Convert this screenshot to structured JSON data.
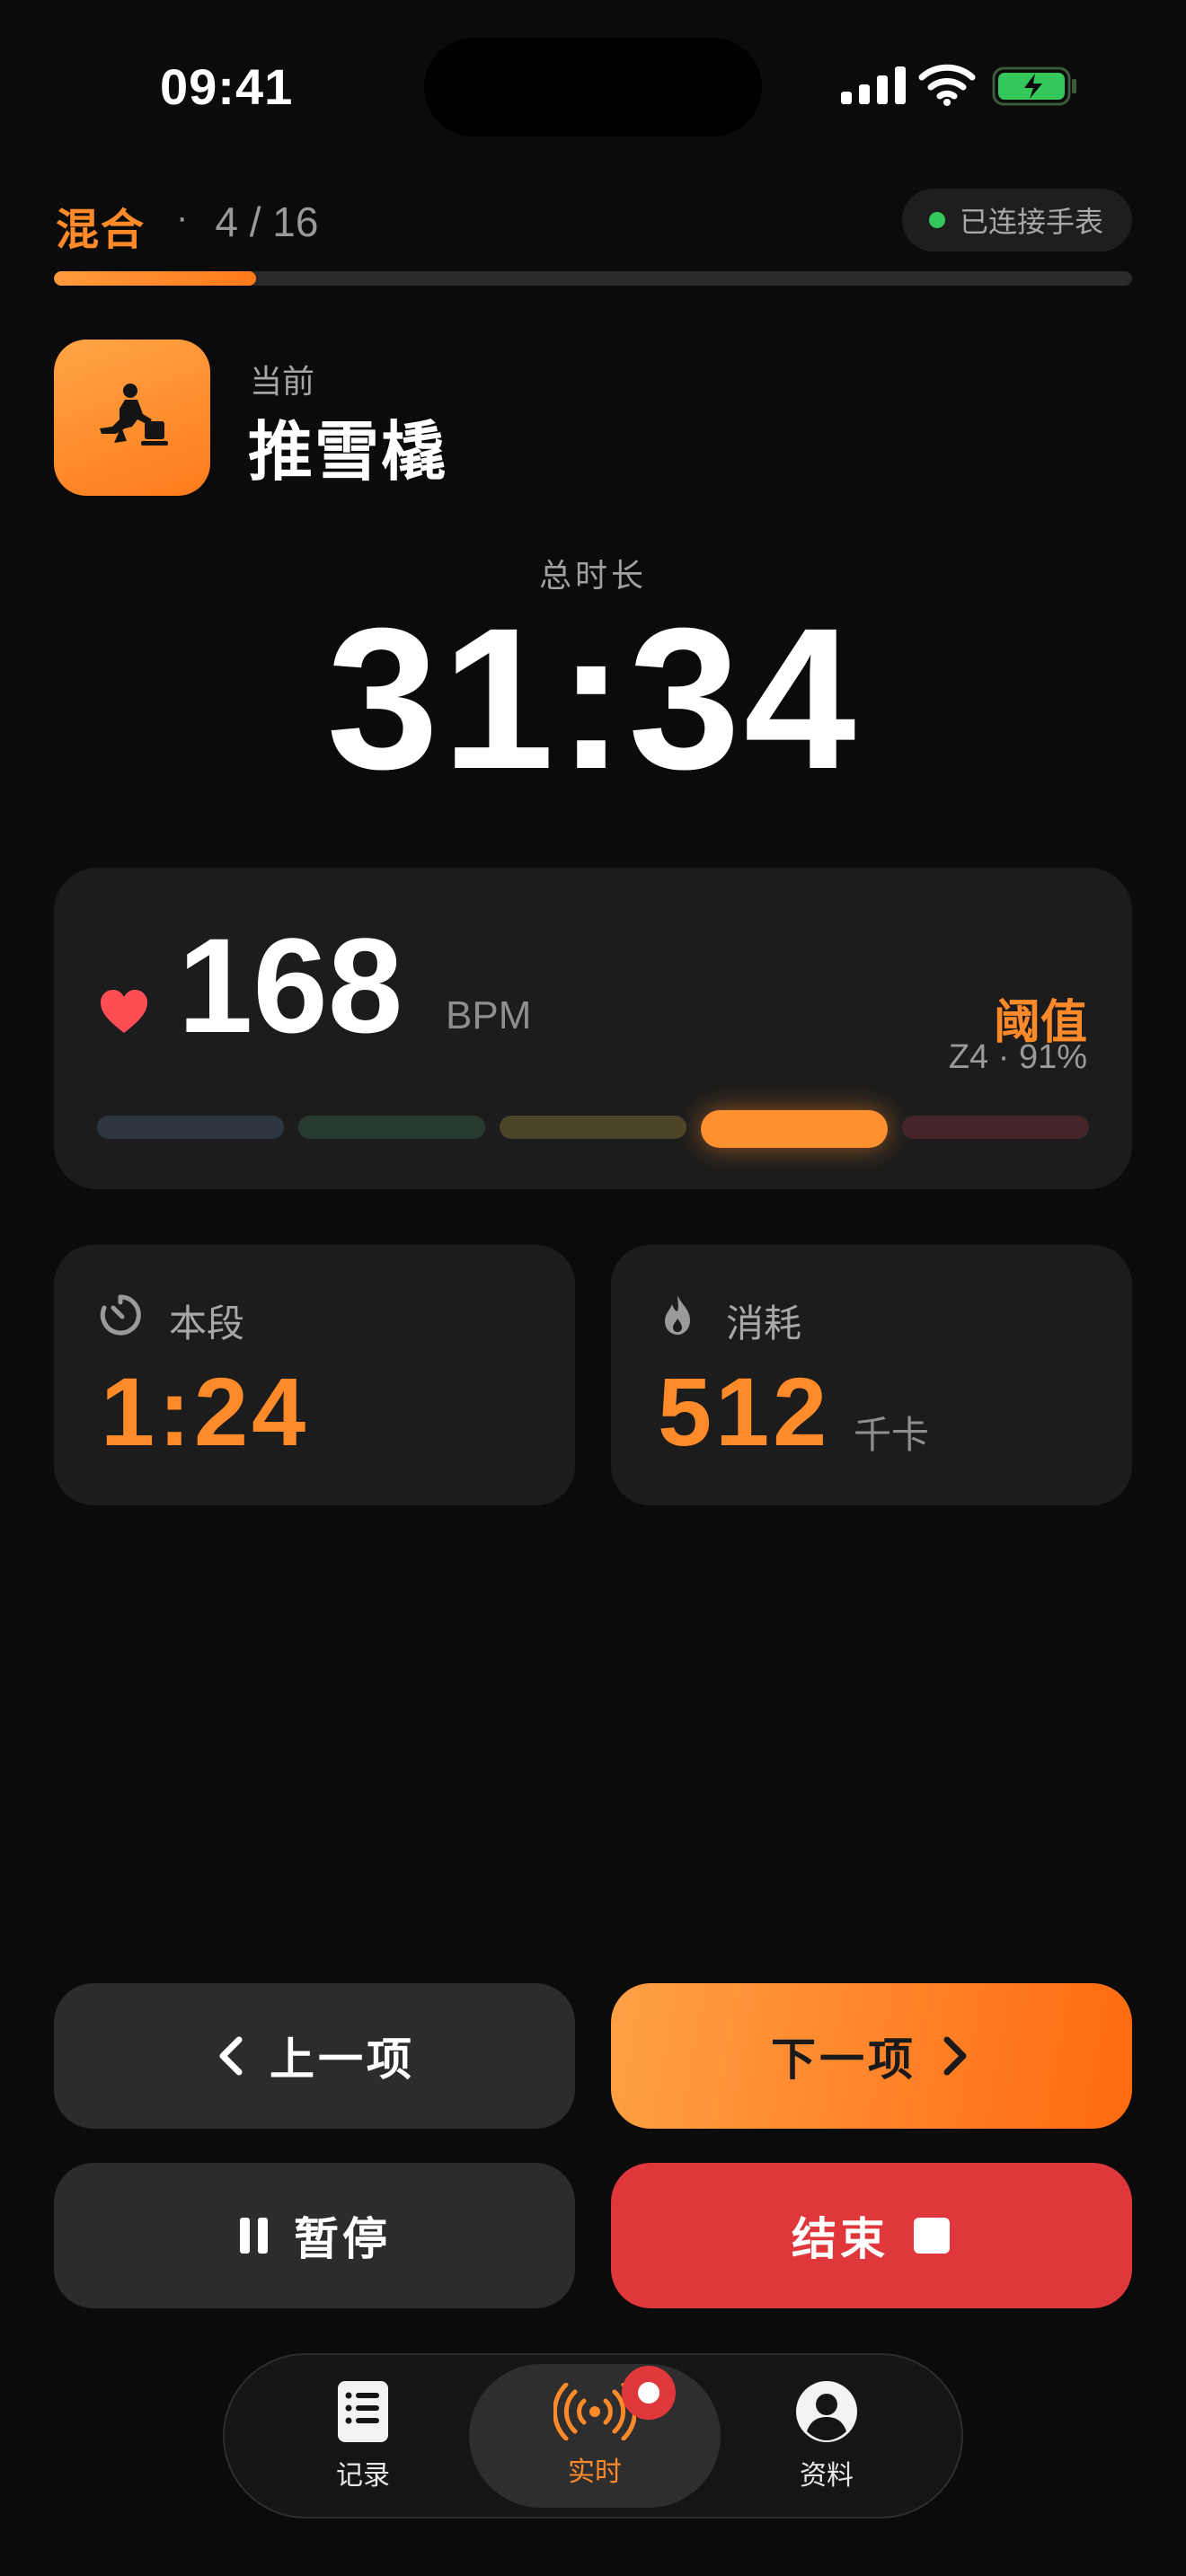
{
  "status_bar": {
    "time": "09:41"
  },
  "header": {
    "mode": "混合",
    "separator": "·",
    "progress": "4 / 16",
    "progress_fraction": 0.1875,
    "watch_status": "已连接手表"
  },
  "current": {
    "label": "当前",
    "name": "推雪橇",
    "icon": "sled-push-icon"
  },
  "total": {
    "label": "总时长",
    "time": "31:34"
  },
  "heart_rate": {
    "value": "168",
    "unit": "BPM",
    "zone_name": "阈值",
    "zone_detail": "Z4 · 91%",
    "active_zone": 4,
    "zone_colors": [
      "#2d3640",
      "#283a30",
      "#4a4428",
      "#ff9030",
      "#45242a"
    ]
  },
  "stats": {
    "segment": {
      "label": "本段",
      "value": "1:24",
      "icon": "timer-icon"
    },
    "calories": {
      "label": "消耗",
      "value": "512",
      "unit": "千卡",
      "icon": "flame-icon"
    }
  },
  "buttons": {
    "prev": "上一项",
    "next": "下一项",
    "pause": "暂停",
    "end": "结束"
  },
  "tabs": {
    "log": "记录",
    "live": "实时",
    "profile": "资料"
  },
  "colors": {
    "accent": "#ff8a2a",
    "danger": "#e0373c",
    "online": "#34c759"
  }
}
